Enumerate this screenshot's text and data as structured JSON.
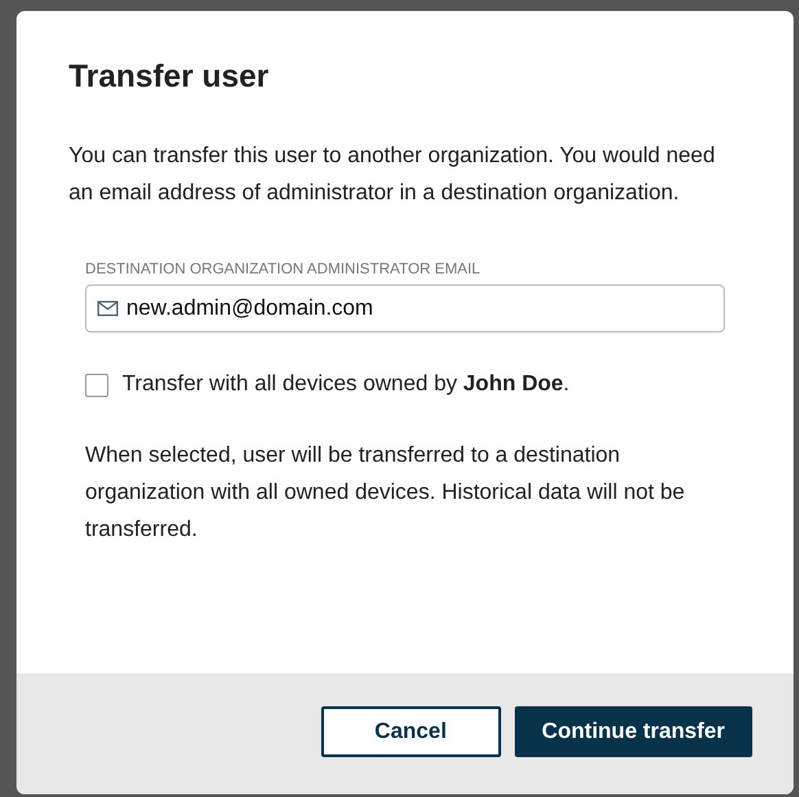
{
  "dialog": {
    "title": "Transfer user",
    "intro": "You can transfer this user to another organization. You would need an email address of administrator in a destination organization.",
    "email_field": {
      "label": "DESTINATION ORGANIZATION ADMINISTRATOR EMAIL",
      "value": "new.admin@domain.com"
    },
    "transfer_devices": {
      "label": "Transfer with all devices owned by **John Doe**.",
      "checked": false
    },
    "note": "When selected, user will be transferred to a destination organization with all owned devices. Historical data will not be transferred.",
    "buttons": [
      {
        "label": "Cancel",
        "kind": "secondary"
      },
      {
        "label": "Continue transfer",
        "kind": "primary"
      }
    ]
  }
}
